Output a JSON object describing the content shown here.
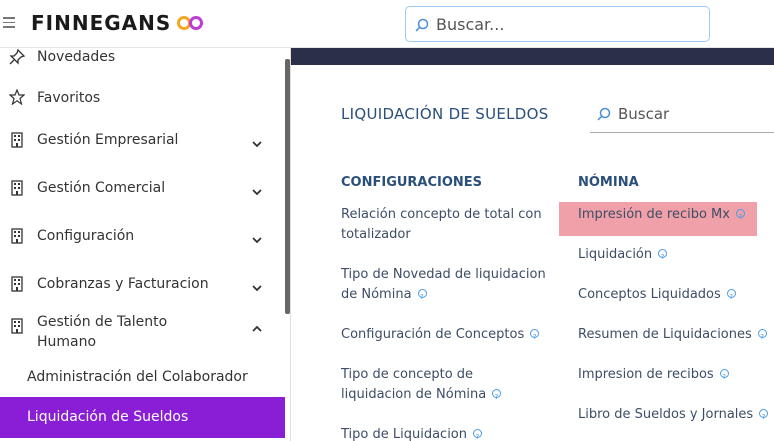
{
  "brand": {
    "name": "FINNEGANS"
  },
  "search_top": {
    "placeholder": "Buscar..."
  },
  "sidebar": {
    "items": [
      {
        "label": "Novedades",
        "icon": "pin-icon"
      },
      {
        "label": "Favoritos",
        "icon": "star-icon"
      },
      {
        "label": "Gestión Empresarial",
        "icon": "building-icon"
      },
      {
        "label": "Gestión Comercial",
        "icon": "building-icon"
      },
      {
        "label": "Configuración",
        "icon": "building-icon"
      },
      {
        "label": "Cobranzas y Facturacion",
        "icon": "building-icon"
      },
      {
        "label_line1": "Gestión de Talento",
        "label_line2": "Humano",
        "icon": "building-icon"
      }
    ],
    "sub_items": [
      {
        "label": "Administración del Colaborador"
      },
      {
        "label": "Liquidación de Sueldos",
        "active": true
      }
    ],
    "active_color": "#8a1ed6"
  },
  "main": {
    "title": "LIQUIDACIÓN DE SUELDOS",
    "search_placeholder": "Buscar",
    "columns": [
      {
        "heading": "CONFIGURACIONES",
        "links": [
          {
            "line1": "Relación concepto de total con",
            "line2": "totalizador"
          },
          {
            "line1": "Tipo de Novedad de liquidacion",
            "line2": "de Nómina"
          },
          {
            "line1": "Configuración de Conceptos"
          },
          {
            "line1": "Tipo de concepto de",
            "line2": "liquidacion de Nómina"
          },
          {
            "line1": "Tipo de Liquidacion"
          }
        ]
      },
      {
        "heading": "NÓMINA",
        "links": [
          {
            "line1": "Impresión de recibo Mx",
            "highlighted": true
          },
          {
            "line1": "Liquidación"
          },
          {
            "line1": "Conceptos Liquidados"
          },
          {
            "line1": "Resumen de Liquidaciones"
          },
          {
            "line1": "Impresion de recibos"
          },
          {
            "line1": "Libro de Sueldos y Jornales"
          }
        ]
      }
    ]
  },
  "colors": {
    "banner": "#2b2f48",
    "heading": "#2a4f7a",
    "highlight": "#f0a0a8",
    "info": "#4a9be6"
  }
}
